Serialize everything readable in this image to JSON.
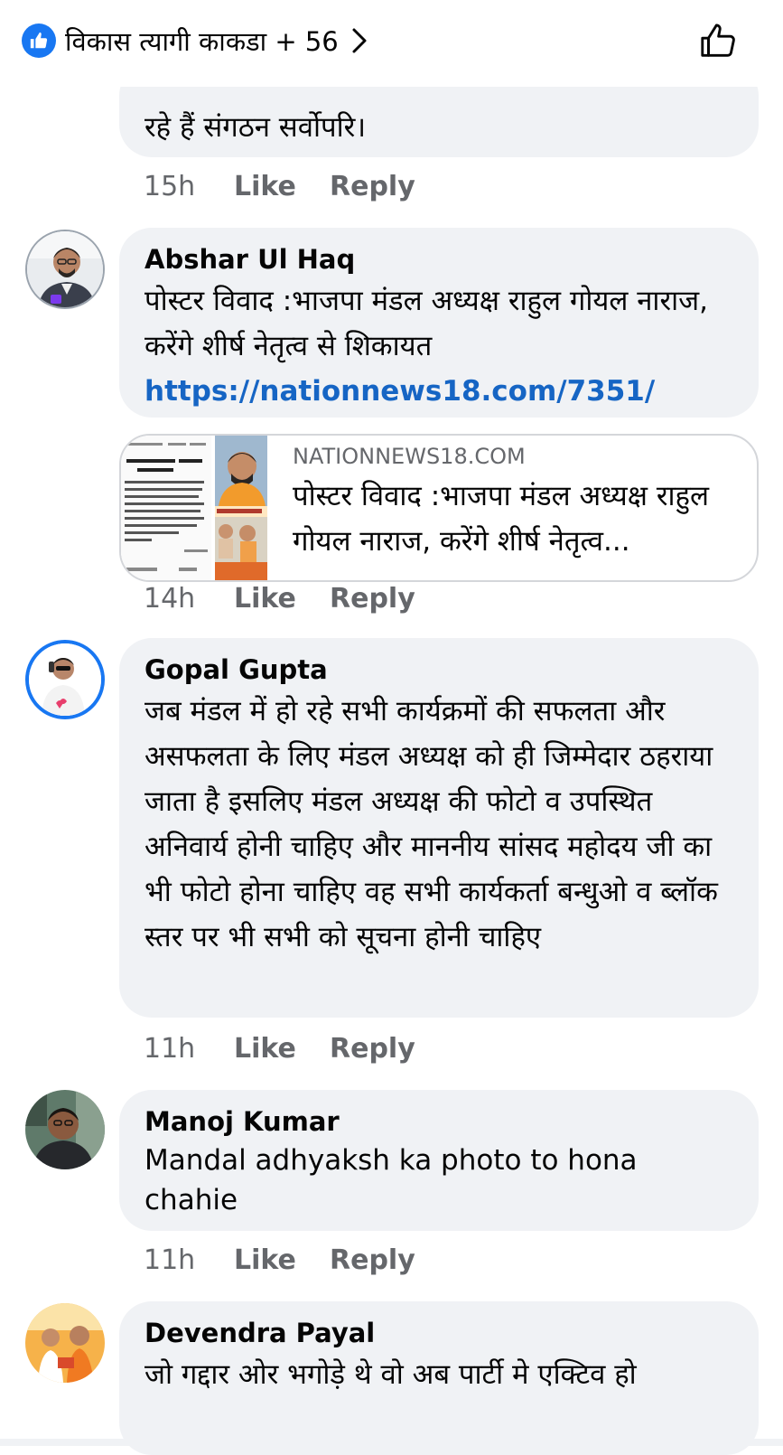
{
  "header": {
    "reactors_text": "विकास त्यागी काकडा + 56"
  },
  "comments": [
    {
      "text": "रहे हैं संगठन सर्वोपरि।",
      "time": "15h",
      "like_label": "Like",
      "reply_label": "Reply"
    },
    {
      "author": "Abshar Ul Haq",
      "text": "पोस्टर विवाद :भाजपा मंडल अध्यक्ष राहुल गोयल नाराज, करेंगे शीर्ष नेतृत्व से शिकायत",
      "link": "https://nationnews18.com/7351/",
      "preview": {
        "domain": "NATIONNEWS18.COM",
        "title": "पोस्टर विवाद :भाजपा मंडल अध्यक्ष राहुल गोयल नाराज, करेंगे शीर्ष नेतृत्व..."
      },
      "time": "14h",
      "like_label": "Like",
      "reply_label": "Reply"
    },
    {
      "author": "Gopal Gupta",
      "text": "जब मंडल में हो रहे सभी कार्यक्रमों की सफलता और असफलता के लिए मंडल अध्यक्ष को ही जिम्मेदार ठहराया जाता है इसलिए मंडल अध्यक्ष की फोटो व उपस्थित अनिवार्य होनी चाहिए और माननीय सांसद महोदय जी का भी फोटो होना चाहिए वह सभी कार्यकर्ता बन्धुओ व ब्लॉक स्तर पर भी सभी को सूचना होनी चाहिए",
      "time": "11h",
      "like_label": "Like",
      "reply_label": "Reply"
    },
    {
      "author": "Manoj Kumar",
      "text": "Mandal adhyaksh ka photo to hona chahie",
      "time": "11h",
      "like_label": "Like",
      "reply_label": "Reply"
    },
    {
      "author": "Devendra Payal",
      "text": "जो गद्दार ओर भगोड़े थे वो अब पार्टी मे एक्टिव हो"
    }
  ],
  "colors": {
    "accent": "#1877f2",
    "link": "#1665c4",
    "bubble": "#f0f2f5",
    "meta": "#65676b"
  },
  "icons": {
    "reaction_badge": "like-badge-icon",
    "header_chevron": "chevron-right-icon",
    "header_like": "thumbs-up-outline-icon"
  }
}
